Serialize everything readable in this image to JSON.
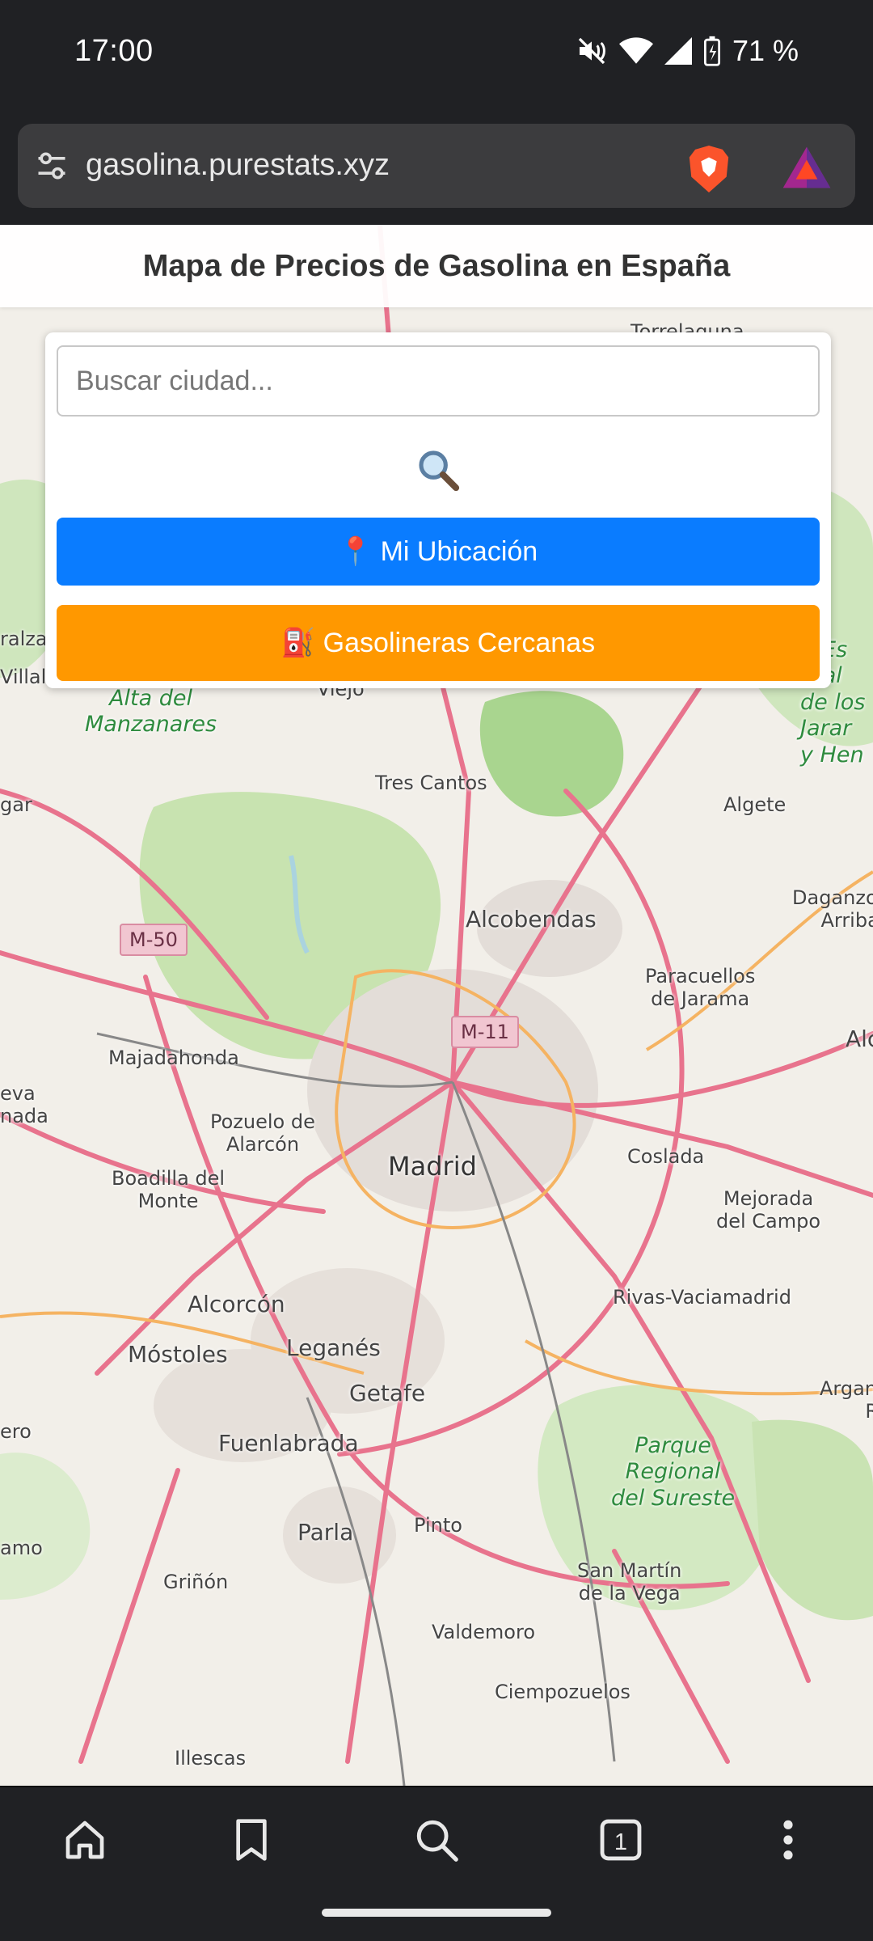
{
  "status_bar": {
    "time": "17:00",
    "battery": "71 %",
    "icons": [
      "mute-icon",
      "wifi-icon",
      "signal-icon",
      "battery-charging-icon"
    ]
  },
  "browser": {
    "url": "gasolina.purestats.xyz",
    "icons": [
      "site-settings-icon",
      "brave-shields-icon",
      "brave-rewards-icon"
    ]
  },
  "page": {
    "title": "Mapa de Precios de Gasolina en España",
    "search": {
      "placeholder": "Buscar ciudad...",
      "value": ""
    },
    "search_button": "🔍",
    "location_button": "📍 Mi Ubicación",
    "nearby_button": "⛽ Gasolineras Cercanas"
  },
  "map": {
    "places": {
      "madrid": "Madrid",
      "alcobendas": "Alcobendas",
      "tres_cantos": "Tres Cantos",
      "algete": "Algete",
      "daganzo": "Daganzo de\nArriba",
      "paracuellos": "Paracuellos\nde Jarama",
      "majadahonda": "Majadahonda",
      "pozuelo": "Pozuelo de\nAlarcón",
      "boadilla": "Boadilla del\nMonte",
      "coslada": "Coslada",
      "mejorada": "Mejorada\ndel Campo",
      "rivas": "Rivas-Vaciamadrid",
      "alcorcon": "Alcorcón",
      "mostoles": "Móstoles",
      "leganes": "Leganés",
      "getafe": "Getafe",
      "fuenlabrada": "Fuenlabrada",
      "parla": "Parla",
      "pinto": "Pinto",
      "grinon": "Griñón",
      "san_martin": "San Martín\nde la Vega",
      "valdemoro": "Valdemoro",
      "ciempozuelos": "Ciempozuelos",
      "illescas": "Illescas",
      "arganda": "Arganda\nRey",
      "villalba": "Villalba",
      "viejo": "Viejo",
      "alzal": "ralza",
      "gar": "gar",
      "eva": "eva\nnada",
      "ero": "ero",
      "amo": "amo",
      "alc_right": "Alc",
      "torrelaguna": "Torrelaguna"
    },
    "parks": {
      "manzanares": "Alta del\nManzanares",
      "jarama": "A Es\nreal\nde los\nJarar\ny Hen",
      "sureste": "Parque\nRegional\ndel Sureste"
    },
    "roads": {
      "m50": "M-50",
      "m11": "M-11"
    }
  },
  "bottom_nav": {
    "tab_count": "1",
    "icons": [
      "home-icon",
      "bookmark-icon",
      "search-icon",
      "tabs-icon",
      "more-icon"
    ]
  }
}
